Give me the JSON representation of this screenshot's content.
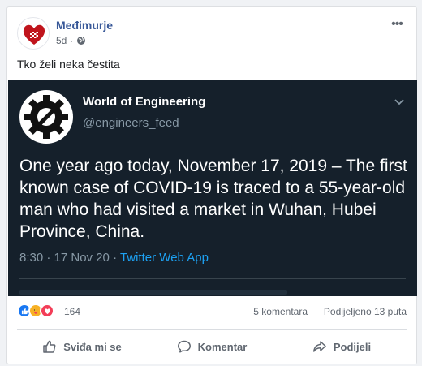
{
  "post": {
    "page_name": "Međimurje",
    "time": "5d",
    "privacy_icon": "globe-icon",
    "text": "Tko želi neka čestita",
    "avatar_label": "Međimurje"
  },
  "tweet": {
    "name": "World of Engineering",
    "handle": "@engineers_feed",
    "body": "One year ago today, November 17, 2019 – The first known case of COVID-19 is traced to a 55-year-old man who had visited a market in Wuhan, Hubei Province, China.",
    "time": "8:30 · 17 Nov 20 · ",
    "app": "Twitter Web App"
  },
  "stats": {
    "reaction_count": "164",
    "comments": "5 komentara",
    "shares": "Podijeljeno 13 puta"
  },
  "actions": {
    "like": "Sviđa mi se",
    "comment": "Komentar",
    "share": "Podijeli"
  },
  "colors": {
    "link": "#385898",
    "tweet_bg": "#15202b",
    "twitter_blue": "#1da1f2"
  }
}
